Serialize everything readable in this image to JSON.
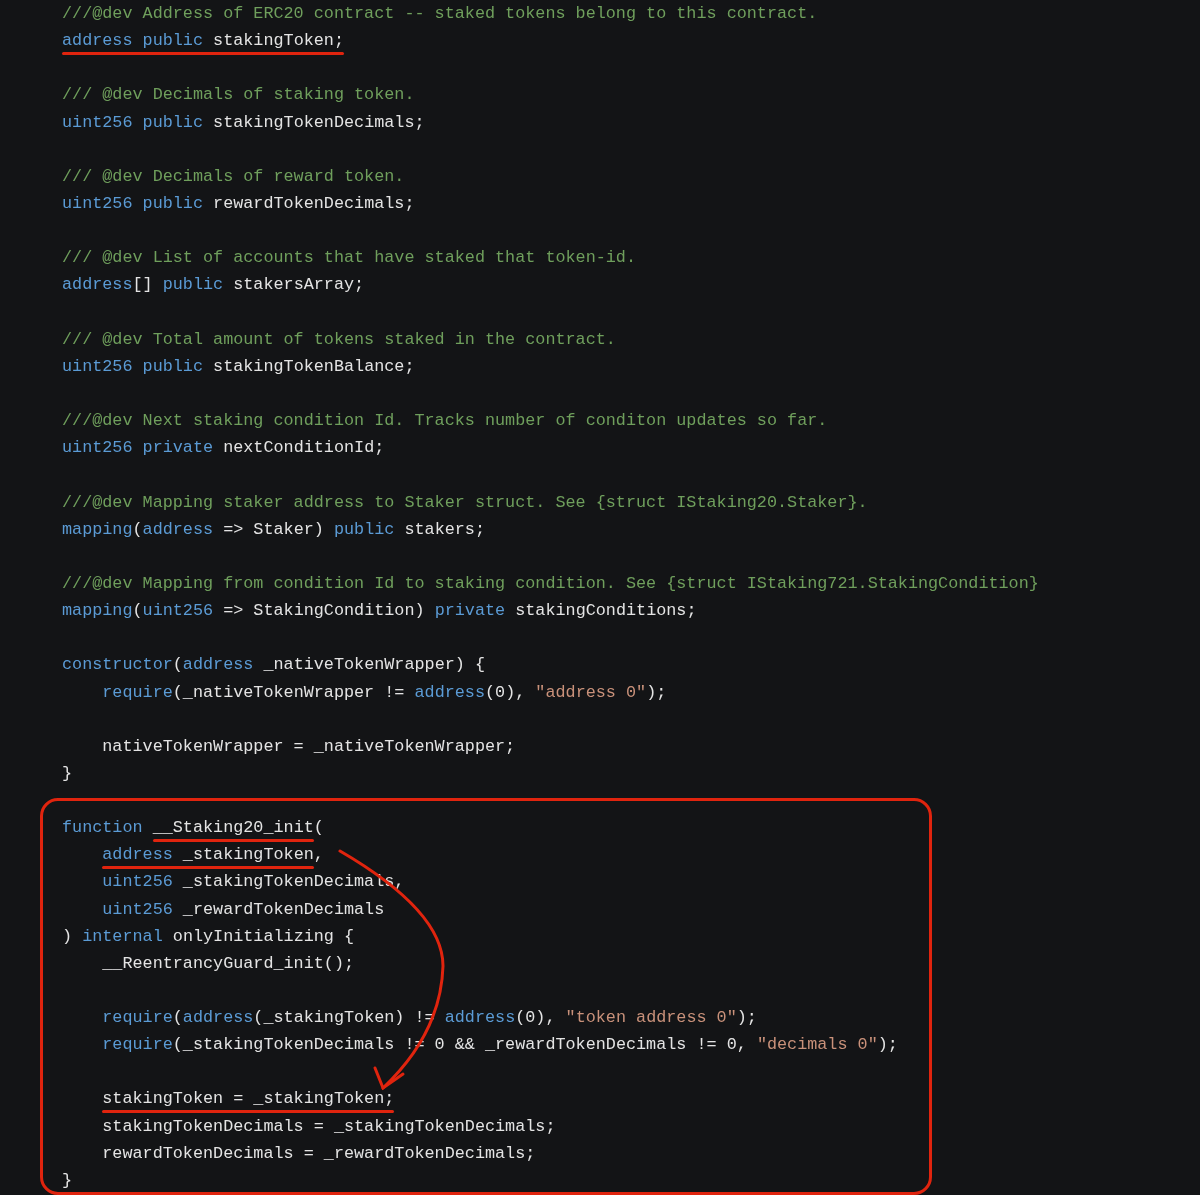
{
  "code_blocks": [
    {
      "groups": [
        [
          [
            {
              "kind": "comment",
              "text": "///@dev Address of ERC20 contract -- staked tokens belong to this contract."
            }
          ],
          [
            {
              "kind": "keyword",
              "text": "address",
              "underline": true
            },
            {
              "kind": "keyword",
              "text": " public",
              "underline": true
            },
            {
              "kind": "plain",
              "text": " stakingToken;",
              "underline": true
            }
          ]
        ],
        [
          [
            {
              "kind": "comment",
              "text": "/// @dev Decimals of staking token."
            }
          ],
          [
            {
              "kind": "keyword",
              "text": "uint256"
            },
            {
              "kind": "keyword",
              "text": " public"
            },
            {
              "kind": "plain",
              "text": " stakingTokenDecimals;"
            }
          ]
        ],
        [
          [
            {
              "kind": "comment",
              "text": "/// @dev Decimals of reward token."
            }
          ],
          [
            {
              "kind": "keyword",
              "text": "uint256"
            },
            {
              "kind": "keyword",
              "text": " public"
            },
            {
              "kind": "plain",
              "text": " rewardTokenDecimals;"
            }
          ]
        ],
        [
          [
            {
              "kind": "comment",
              "text": "/// @dev List of accounts that have staked that token-id."
            }
          ],
          [
            {
              "kind": "keyword",
              "text": "address"
            },
            {
              "kind": "plain",
              "text": "[]"
            },
            {
              "kind": "keyword",
              "text": " public"
            },
            {
              "kind": "plain",
              "text": " stakersArray;"
            }
          ]
        ],
        [
          [
            {
              "kind": "comment",
              "text": "/// @dev Total amount of tokens staked in the contract."
            }
          ],
          [
            {
              "kind": "keyword",
              "text": "uint256"
            },
            {
              "kind": "keyword",
              "text": " public"
            },
            {
              "kind": "plain",
              "text": " stakingTokenBalance;"
            }
          ]
        ],
        [
          [
            {
              "kind": "comment",
              "text": "///@dev Next staking condition Id. Tracks number of conditon updates so far."
            }
          ],
          [
            {
              "kind": "keyword",
              "text": "uint256"
            },
            {
              "kind": "keyword",
              "text": " private"
            },
            {
              "kind": "plain",
              "text": " nextConditionId;"
            }
          ]
        ],
        [
          [
            {
              "kind": "comment",
              "text": "///@dev Mapping staker address to Staker struct. See {struct IStaking20.Staker}."
            }
          ],
          [
            {
              "kind": "keyword",
              "text": "mapping"
            },
            {
              "kind": "plain",
              "text": "("
            },
            {
              "kind": "keyword",
              "text": "address"
            },
            {
              "kind": "plain",
              "text": " => Staker)"
            },
            {
              "kind": "keyword",
              "text": " public"
            },
            {
              "kind": "plain",
              "text": " stakers;"
            }
          ]
        ],
        [
          [
            {
              "kind": "comment",
              "text": "///@dev Mapping from condition Id to staking condition. See {struct IStaking721.StakingCondition}"
            }
          ],
          [
            {
              "kind": "keyword",
              "text": "mapping"
            },
            {
              "kind": "plain",
              "text": "("
            },
            {
              "kind": "keyword",
              "text": "uint256"
            },
            {
              "kind": "plain",
              "text": " => StakingCondition)"
            },
            {
              "kind": "keyword",
              "text": " private"
            },
            {
              "kind": "plain",
              "text": " stakingConditions;"
            }
          ]
        ],
        [
          [
            {
              "kind": "keyword",
              "text": "constructor"
            },
            {
              "kind": "plain",
              "text": "("
            },
            {
              "kind": "keyword",
              "text": "address"
            },
            {
              "kind": "plain",
              "text": " _nativeTokenWrapper) {"
            }
          ],
          [
            {
              "kind": "keyword",
              "text": "    require"
            },
            {
              "kind": "plain",
              "text": "(_nativeTokenWrapper != "
            },
            {
              "kind": "keyword",
              "text": "address"
            },
            {
              "kind": "plain",
              "text": "(0), "
            },
            {
              "kind": "string",
              "text": "\"address 0\""
            },
            {
              "kind": "plain",
              "text": ");"
            }
          ]
        ],
        [
          [
            {
              "kind": "plain",
              "text": "    nativeTokenWrapper = _nativeTokenWrapper;"
            }
          ],
          [
            {
              "kind": "plain",
              "text": "}"
            }
          ]
        ]
      ]
    },
    {
      "boxed": true,
      "groups": [
        [
          [
            {
              "kind": "keyword",
              "text": "function"
            },
            {
              "kind": "plain",
              "text": " __Staking20_init",
              "underline": true
            },
            {
              "kind": "plain",
              "text": "("
            }
          ],
          [
            {
              "kind": "keyword",
              "text": "    address",
              "underline": true
            },
            {
              "kind": "plain",
              "text": " _stakingToken",
              "underline": true
            },
            {
              "kind": "plain",
              "text": ","
            }
          ],
          [
            {
              "kind": "keyword",
              "text": "    uint256"
            },
            {
              "kind": "plain",
              "text": " _stakingTokenDecimals,"
            }
          ],
          [
            {
              "kind": "keyword",
              "text": "    uint256"
            },
            {
              "kind": "plain",
              "text": " _rewardTokenDecimals"
            }
          ],
          [
            {
              "kind": "plain",
              "text": ") "
            },
            {
              "kind": "keyword",
              "text": "internal"
            },
            {
              "kind": "plain",
              "text": " onlyInitializing {"
            }
          ],
          [
            {
              "kind": "plain",
              "text": "    __ReentrancyGuard_init();"
            }
          ]
        ],
        [
          [
            {
              "kind": "keyword",
              "text": "    require"
            },
            {
              "kind": "plain",
              "text": "("
            },
            {
              "kind": "keyword",
              "text": "address"
            },
            {
              "kind": "plain",
              "text": "(_stakingToken) != "
            },
            {
              "kind": "keyword",
              "text": "address"
            },
            {
              "kind": "plain",
              "text": "(0), "
            },
            {
              "kind": "string",
              "text": "\"token address 0\""
            },
            {
              "kind": "plain",
              "text": ");"
            }
          ],
          [
            {
              "kind": "keyword",
              "text": "    require"
            },
            {
              "kind": "plain",
              "text": "(_stakingTokenDecimals != 0 && _rewardTokenDecimals != 0, "
            },
            {
              "kind": "string",
              "text": "\"decimals 0\""
            },
            {
              "kind": "plain",
              "text": ");"
            }
          ]
        ],
        [
          [
            {
              "kind": "plain",
              "text": "    stakingToken = _stakingToken;",
              "underline": true
            }
          ],
          [
            {
              "kind": "plain",
              "text": "    stakingTokenDecimals = _stakingTokenDecimals;"
            }
          ],
          [
            {
              "kind": "plain",
              "text": "    rewardTokenDecimals = _rewardTokenDecimals;"
            }
          ],
          [
            {
              "kind": "plain",
              "text": "}"
            }
          ]
        ]
      ]
    }
  ]
}
